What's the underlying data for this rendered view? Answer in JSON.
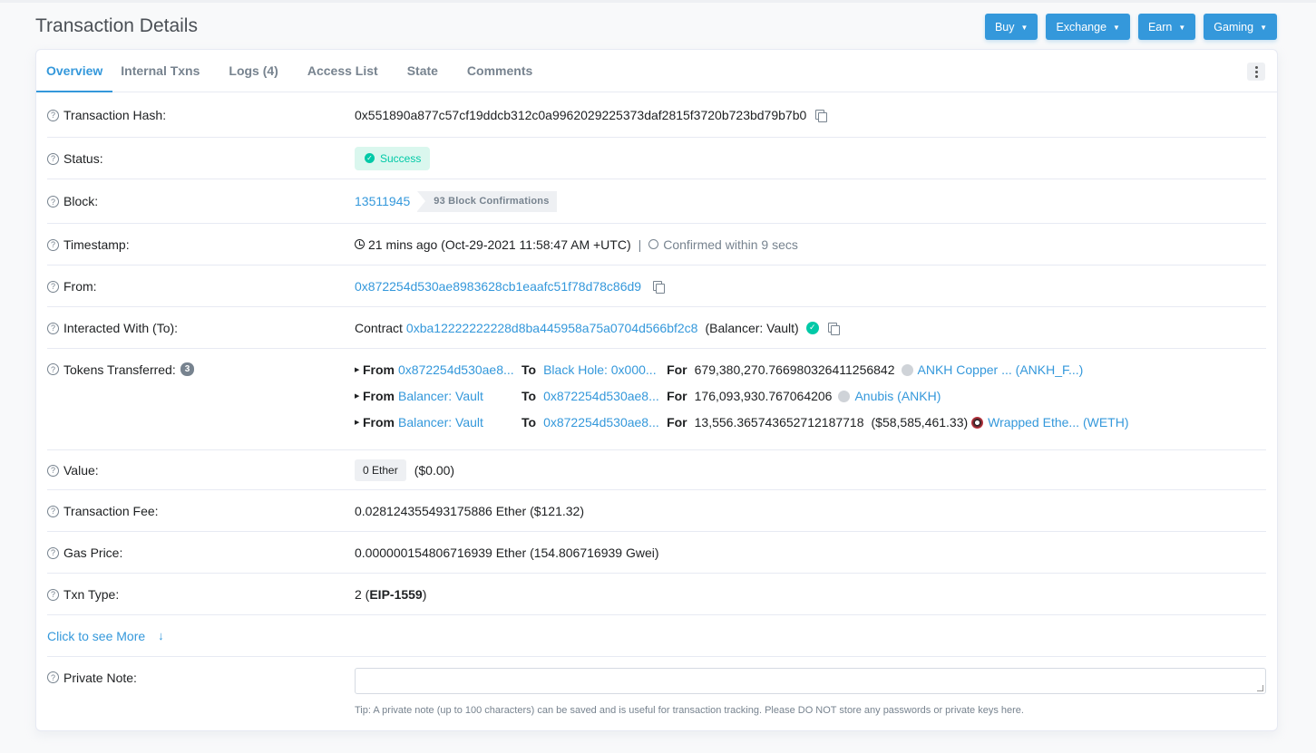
{
  "page": {
    "title": "Transaction Details"
  },
  "top_buttons": [
    {
      "label": "Buy"
    },
    {
      "label": "Exchange"
    },
    {
      "label": "Earn"
    },
    {
      "label": "Gaming"
    }
  ],
  "tabs": [
    {
      "label": "Overview",
      "active": true
    },
    {
      "label": "Internal Txns"
    },
    {
      "label": "Logs (4)"
    },
    {
      "label": "Access List"
    },
    {
      "label": "State"
    },
    {
      "label": "Comments"
    }
  ],
  "fields": {
    "tx_hash": {
      "label": "Transaction Hash:",
      "value": "0x551890a877c57cf19ddcb312c0a9962029225373daf2815f3720b723bd79b7b0"
    },
    "status": {
      "label": "Status:",
      "value": "Success"
    },
    "block": {
      "label": "Block:",
      "value": "13511945",
      "confirmations": "93 Block Confirmations"
    },
    "timestamp": {
      "label": "Timestamp:",
      "value": "21 mins ago (Oct-29-2021 11:58:47 AM +UTC)",
      "separator": "|",
      "confirmed": "Confirmed within 9 secs"
    },
    "from": {
      "label": "From:",
      "value": "0x872254d530ae8983628cb1eaafc51f78d78c86d9"
    },
    "interacted": {
      "label": "Interacted With (To):",
      "prefix": "Contract",
      "address": "0xba12222222228d8ba445958a75a0704d566bf2c8",
      "name": "(Balancer: Vault)"
    },
    "tokens": {
      "label": "Tokens Transferred:",
      "count": "3",
      "from_label": "From",
      "to_label": "To",
      "for_label": "For",
      "transfers": [
        {
          "from": "0x872254d530ae8...",
          "to": "Black Hole: 0x000...",
          "amount": "679,380,270.766980326411256842",
          "usd": "",
          "token": "ANKH Copper ... (ANKH_F...)"
        },
        {
          "from": "Balancer: Vault",
          "to": "0x872254d530ae8...",
          "amount": "176,093,930.767064206",
          "usd": "",
          "token": "Anubis (ANKH)"
        },
        {
          "from": "Balancer: Vault",
          "to": "0x872254d530ae8...",
          "amount": "13,556.365743652712187718",
          "usd": "($58,585,461.33)",
          "token": "Wrapped Ethe... (WETH)"
        }
      ]
    },
    "value": {
      "label": "Value:",
      "amount": "0 Ether",
      "usd": "($0.00)"
    },
    "fee": {
      "label": "Transaction Fee:",
      "value": "0.028124355493175886 Ether ($121.32)"
    },
    "gas": {
      "label": "Gas Price:",
      "value": "0.000000154806716939 Ether (154.806716939 Gwei)"
    },
    "txn_type": {
      "label": "Txn Type:",
      "num": "2 (",
      "type": "EIP-1559",
      "close": ")"
    },
    "more": {
      "label": "Click to see More"
    },
    "note": {
      "label": "Private Note:",
      "placeholder": "",
      "tip": "Tip: A private note (up to 100 characters) can be saved and is useful for transaction tracking. Please DO NOT store any passwords or private keys here."
    }
  }
}
